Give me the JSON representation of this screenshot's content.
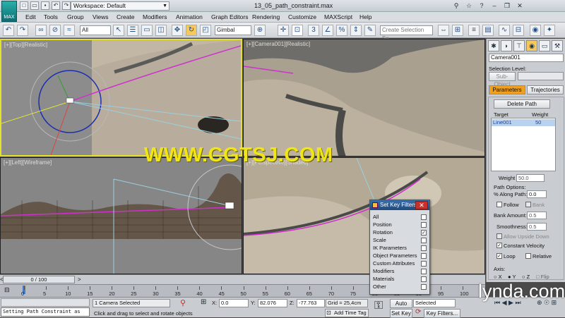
{
  "window": {
    "title": "13_05_path_constraint.max",
    "workspace": "Workspace: Default",
    "logo_label": "MAX"
  },
  "menu": [
    "Edit",
    "Tools",
    "Group",
    "Views",
    "Create",
    "Modifiers",
    "Animation",
    "Graph Editors",
    "Rendering",
    "Customize",
    "MAXScript",
    "Help"
  ],
  "toolbar": {
    "filter_value": "All",
    "coord_value": "Gimbal",
    "selection_set_placeholder": "Create Selection Se"
  },
  "viewports": {
    "top": "[+][Top][Realistic]",
    "camera": "[+][Camera001][Realistic]",
    "left": "[+][Left][Wireframe]",
    "persp": "[+][Perspective][Shaded]"
  },
  "cmd": {
    "object_name": "Camera001",
    "selection_level": "Selection Level:",
    "sub_object": "Sub-Object",
    "tab_parameters": "Parameters",
    "tab_trajectories": "Trajectories",
    "delete_path": "Delete Path",
    "col_target": "Target",
    "col_weight": "Weight",
    "target_name": "Line001",
    "target_weight": "50",
    "weight_label": "Weight",
    "weight_value": "50.0",
    "path_options": "Path Options:",
    "along_path_label": "% Along Path:",
    "along_path_value": "0.0",
    "follow": "Follow",
    "bank": "Bank",
    "bank_amount_label": "Bank Amount:",
    "bank_amount_value": "0.5",
    "smoothness_label": "Smoothness:",
    "smoothness_value": "0.5",
    "allow_upside_down": "Allow Upside Down",
    "constant_velocity": "Constant Velocity",
    "loop": "Loop",
    "relative": "Relative",
    "axis_label": "Axis:",
    "axis_x": "X",
    "axis_y": "Y",
    "axis_z": "Z",
    "flip": "Flip"
  },
  "key_filters": {
    "title": "Set Key Filters",
    "items": [
      {
        "label": "All",
        "checked": false
      },
      {
        "label": "Position",
        "checked": false
      },
      {
        "label": "Rotation",
        "checked": true
      },
      {
        "label": "Scale",
        "checked": false
      },
      {
        "label": "IK Parameters",
        "checked": false
      },
      {
        "label": "Object Parameters",
        "checked": false
      },
      {
        "label": "Custom Attributes",
        "checked": false
      },
      {
        "label": "Modifiers",
        "checked": false
      },
      {
        "label": "Materials",
        "checked": false
      },
      {
        "label": "Other",
        "checked": false
      }
    ]
  },
  "timeline": {
    "frame_counter": "0 / 100",
    "ticks": [
      "0",
      "5",
      "10",
      "15",
      "20",
      "25",
      "30",
      "35",
      "40",
      "45",
      "50",
      "55",
      "60",
      "65",
      "70",
      "75",
      "80",
      "85",
      "90",
      "95",
      "100"
    ],
    "current_frame": 0
  },
  "status": {
    "maxscript": "Setting Path Constraint as",
    "selected": "1 Camera Selected",
    "prompt": "Click and drag to select and rotate objects",
    "x_label": "X:",
    "x_value": "0.0",
    "y_label": "Y:",
    "y_value": "82.076",
    "z_label": "Z:",
    "z_value": "-77.763",
    "grid": "Grid = 25,4cm",
    "add_time_tag": "Add Time Tag",
    "auto_key": "Auto Key",
    "set_key": "Set Key",
    "selected_mode": "Selected",
    "key_filters": "Key Filters..."
  },
  "watermarks": {
    "center": "WWW.CGTSJ.COM",
    "brand": "lynda.com"
  },
  "colors": {
    "accent": "#f0a020",
    "viewport_active": "#e5e02a",
    "watermark": "#f0e516"
  }
}
